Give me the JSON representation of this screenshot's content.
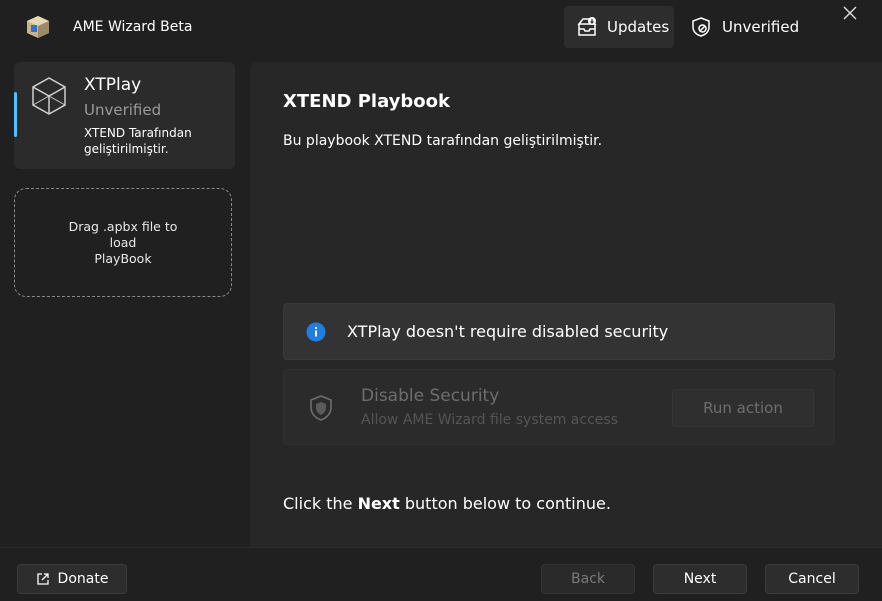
{
  "titlebar": {
    "app_title": "AME Wizard Beta",
    "updates_label": "Updates",
    "unverified_label": "Unverified"
  },
  "sidebar": {
    "playbook": {
      "name": "XTPlay",
      "status": "Unverified",
      "description": "XTEND Tarafından geliştirilmiştir."
    },
    "drop_zone_text": "Drag .apbx file to\nload\nPlayBook"
  },
  "main": {
    "title": "XTEND Playbook",
    "description": "Bu playbook XTEND tarafından geliştirilmiştir.",
    "info_text": "XTPlay doesn't require disabled security",
    "action": {
      "title": "Disable Security",
      "subtitle": "Allow AME Wizard file system access",
      "button_label": "Run action"
    },
    "continue": {
      "prefix": "Click the ",
      "bold": "Next",
      "suffix": " button below to continue."
    }
  },
  "footer": {
    "donate_label": "Donate",
    "back_label": "Back",
    "next_label": "Next",
    "cancel_label": "Cancel"
  },
  "colors": {
    "accent": "#4cc2ff",
    "info_icon": "#1f7fe0",
    "background": "#202020"
  },
  "icons": {
    "app": "ame-cube-icon",
    "updates": "updates-box-icon",
    "unverified": "shield-unverified-icon",
    "close": "close-icon",
    "playbook": "wireframe-cube-icon",
    "info": "info-icon",
    "security": "shield-icon",
    "donate": "external-link-icon"
  }
}
